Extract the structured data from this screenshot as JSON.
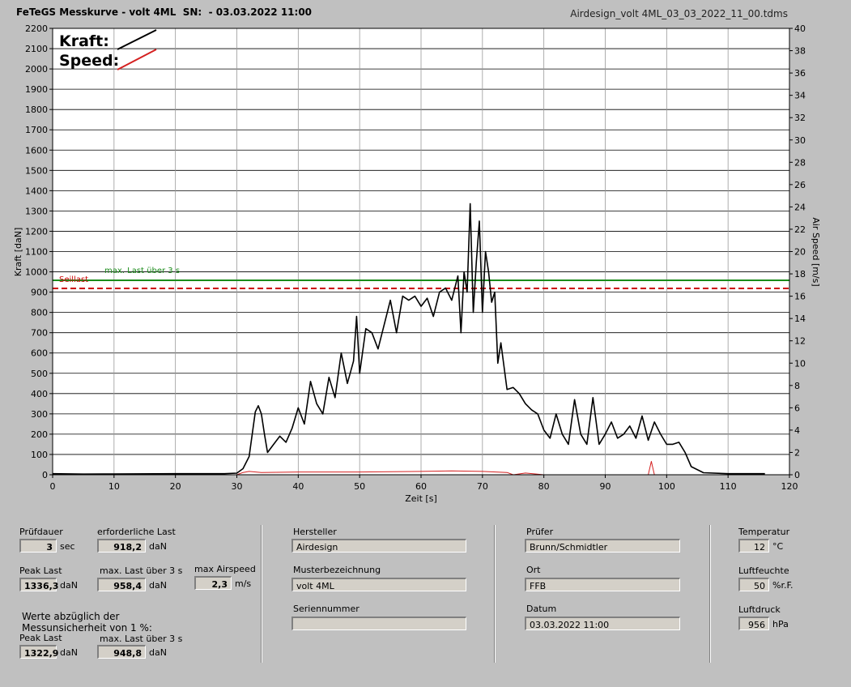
{
  "header": {
    "title": "FeTeGS Messkurve - volt 4ML  SN:  - 03.03.2022 11:00",
    "filename": "Airdesign_volt 4ML_03_03_2022_11_00.tdms"
  },
  "legend": {
    "kraft": "Kraft:",
    "speed": "Speed:"
  },
  "colors": {
    "kraft": "#000000",
    "speed": "#d42020",
    "max_last": "#1a8c1a",
    "seillast": "#cc0000",
    "plot_bg": "#ffffff"
  },
  "chart_data": {
    "type": "line",
    "xlabel": "Zeit [s]",
    "ylabel": "Kraft [daN]",
    "y2label": "Air Speed [m/s]",
    "xlim": [
      0,
      120
    ],
    "ylim": [
      0,
      2200
    ],
    "y2lim": [
      0,
      40
    ],
    "x_ticks": [
      0,
      10,
      20,
      30,
      40,
      50,
      60,
      70,
      80,
      90,
      100,
      110,
      120
    ],
    "y_ticks": [
      0,
      100,
      200,
      300,
      400,
      500,
      600,
      700,
      800,
      900,
      1000,
      1100,
      1200,
      1300,
      1400,
      1500,
      1600,
      1700,
      1800,
      1900,
      2000,
      2100,
      2200
    ],
    "y2_ticks": [
      0,
      2,
      4,
      6,
      8,
      10,
      12,
      14,
      16,
      18,
      20,
      22,
      24,
      26,
      28,
      30,
      32,
      34,
      36,
      38,
      40
    ],
    "grid": true,
    "hlines": [
      {
        "label": "max. Last über  3 s",
        "value": 958.4,
        "color": "#1a8c1a",
        "style": "solid"
      },
      {
        "label": "Seillast",
        "value": 918.2,
        "color": "#cc0000",
        "style": "dashed"
      }
    ],
    "series": [
      {
        "name": "Kraft",
        "axis": "left",
        "color": "#000000",
        "x": [
          0,
          5,
          10,
          20,
          28,
          30,
          31,
          32,
          33,
          33.5,
          34,
          34.5,
          35,
          36,
          37,
          38,
          39,
          40,
          41,
          42,
          43,
          44,
          45,
          46,
          47,
          48,
          49,
          49.5,
          50,
          51,
          52,
          53,
          54,
          55,
          56,
          57,
          58,
          59,
          60,
          61,
          62,
          63,
          64,
          65,
          66,
          66.5,
          67,
          67.5,
          68,
          68.5,
          69,
          69.5,
          70,
          70.5,
          71,
          71.5,
          72,
          72.5,
          73,
          74,
          75,
          76,
          77,
          78,
          79,
          80,
          81,
          82,
          83,
          84,
          85,
          86,
          87,
          88,
          89,
          90,
          91,
          92,
          93,
          94,
          95,
          96,
          97,
          98,
          99,
          100,
          101,
          102,
          103,
          104,
          106,
          110,
          114,
          116
        ],
        "y": [
          5,
          3,
          4,
          5,
          5,
          8,
          30,
          90,
          310,
          340,
          300,
          200,
          110,
          150,
          190,
          160,
          230,
          330,
          250,
          460,
          350,
          300,
          480,
          380,
          600,
          450,
          560,
          780,
          500,
          720,
          700,
          620,
          740,
          860,
          700,
          880,
          860,
          880,
          830,
          870,
          780,
          900,
          920,
          860,
          980,
          700,
          1000,
          900,
          1336,
          800,
          1050,
          1250,
          800,
          1100,
          1000,
          850,
          900,
          550,
          650,
          420,
          430,
          400,
          350,
          320,
          300,
          220,
          180,
          300,
          200,
          150,
          370,
          200,
          150,
          380,
          150,
          200,
          260,
          180,
          200,
          240,
          180,
          290,
          170,
          260,
          200,
          150,
          150,
          160,
          110,
          40,
          10,
          5,
          5,
          5
        ]
      },
      {
        "name": "Speed",
        "axis": "right",
        "color": "#d42020",
        "x": [
          0,
          30,
          31,
          32,
          34,
          40,
          50,
          60,
          65,
          70,
          74,
          75,
          77,
          80,
          90,
          96,
          97,
          97.5,
          98,
          99,
          120
        ],
        "y": [
          0,
          0,
          0.2,
          0.3,
          0.2,
          0.25,
          0.25,
          0.3,
          0.35,
          0.3,
          0.2,
          0,
          0.15,
          0,
          0,
          0,
          0,
          1.2,
          0,
          0,
          0
        ]
      }
    ]
  },
  "panel": {
    "pruefdauer": {
      "label": "Prüfdauer",
      "value": "3",
      "unit": "sec"
    },
    "erforderliche_last": {
      "label": "erforderliche Last",
      "value": "918,2",
      "unit": "daN"
    },
    "peak_last": {
      "label": "Peak Last",
      "value": "1336,3",
      "unit": "daN"
    },
    "max_last_3s": {
      "label": "max. Last über  3 s",
      "value": "958,4",
      "unit": "daN"
    },
    "max_airspeed": {
      "label": "max Airspeed",
      "value": "2,3",
      "unit": "m/s"
    },
    "werte_note_line1": "Werte abzüglich der",
    "werte_note_line2": "Messunsicherheit von 1  %:",
    "peak_last_corr": {
      "label": "Peak Last",
      "value": "1322,9",
      "unit": "daN"
    },
    "max_last_3s_corr": {
      "label": "max. Last über  3 s",
      "value": "948,8",
      "unit": "daN"
    },
    "hersteller": {
      "label": "Hersteller",
      "value": "Airdesign"
    },
    "musterbezeichnung": {
      "label": "Musterbezeichnung",
      "value": "volt 4ML"
    },
    "seriennummer": {
      "label": "Seriennummer",
      "value": ""
    },
    "pruefer": {
      "label": "Prüfer",
      "value": "Brunn/Schmidtler"
    },
    "ort": {
      "label": "Ort",
      "value": "FFB"
    },
    "datum": {
      "label": "Datum",
      "value": "03.03.2022 11:00"
    },
    "temperatur": {
      "label": "Temperatur",
      "value": "12",
      "unit": "°C"
    },
    "luftfeuchte": {
      "label": "Luftfeuchte",
      "value": "50",
      "unit": "%r.F."
    },
    "luftdruck": {
      "label": "Luftdruck",
      "value": "956",
      "unit": "hPa"
    }
  }
}
